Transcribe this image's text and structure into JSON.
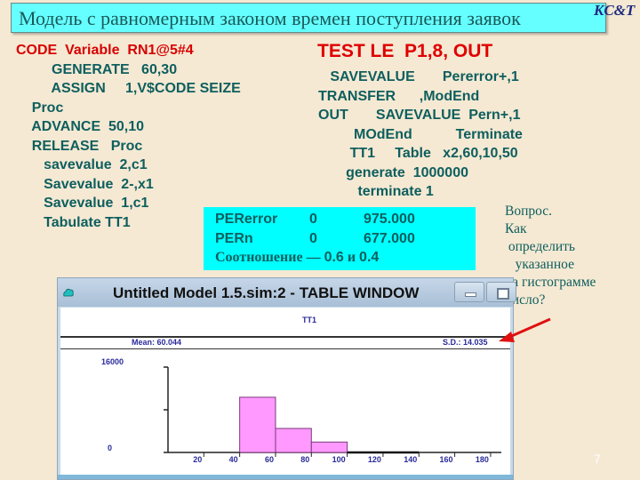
{
  "slide": {
    "title": "Модель с равномерным законом времен поступления заявок",
    "logo": "KC&T",
    "page_number": "7",
    "colors": {
      "title_bg": "#66ffff",
      "code_text": "#0e5e5e",
      "code_red": "#d80000",
      "result_bg": "#00ffff",
      "bar_fill": "#ff99ff",
      "arrow": "#e00000"
    }
  },
  "code_left": [
    {
      "text": "CODE  Variable  RN1@5#4",
      "red": true
    },
    {
      "text": "         GENERATE   60,30",
      "red": false
    },
    {
      "text": "         ASSIGN     1,V$CODE SEIZE",
      "red": false
    },
    {
      "text": "    Proc",
      "red": false
    },
    {
      "text": "    ADVANCE  50,10",
      "red": false
    },
    {
      "text": "    RELEASE   Proc",
      "red": false
    },
    {
      "text": "       savevalue  2,c1",
      "red": false
    },
    {
      "text": "       Savevalue  2-,x1",
      "red": false
    },
    {
      "text": "       Savevalue  1,c1",
      "red": false
    },
    {
      "text": "       Tabulate TT1",
      "red": false
    }
  ],
  "code_right": {
    "heading": "TEST LE  P1,8, OUT",
    "lines": [
      "   SAVEVALUE       Pererror+,1",
      "TRANSFER      ,ModEnd",
      "OUT       SAVEVALUE  Pern+,1",
      "         MOdEnd           Terminate",
      "        TT1     Table   x2,60,10,50",
      "       generate  1000000",
      "          terminate 1"
    ]
  },
  "results": {
    "rows": [
      {
        "name": "PERerror",
        "index": "0",
        "value": "975.000"
      },
      {
        "name": "PERn",
        "index": "0",
        "value": "677.000"
      }
    ],
    "ratio_label": "Соотношение — ",
    "ratio_a": "0.6",
    "ratio_and": " и ",
    "ratio_b": "0.4"
  },
  "question": {
    "lines": [
      "Вопрос.",
      "Как",
      " определить",
      "   указанное",
      "на гистограмме",
      "число?"
    ]
  },
  "window": {
    "title": "Untitled Model 1.5.sim:2  -  TABLE WINDOW",
    "table_name": "TT1",
    "mean_label": "Mean: 60.044",
    "sd_label": "S.D.: 14.035"
  },
  "chart_data": {
    "type": "bar",
    "title": "TT1",
    "xlabel": "",
    "ylabel": "",
    "x_ticks": [
      "20",
      "40",
      "60",
      "80",
      "100",
      "120",
      "140",
      "160",
      "180"
    ],
    "y_tick_labels": [
      "16000",
      "0"
    ],
    "ylim": [
      0,
      16000
    ],
    "xlim": [
      0,
      190
    ],
    "bins": [
      {
        "from": 40,
        "to": 60,
        "value": 10350
      },
      {
        "from": 60,
        "to": 80,
        "value": 4500
      },
      {
        "from": 80,
        "to": 100,
        "value": 1950
      }
    ],
    "mean": 60.044,
    "sd": 14.035,
    "grid": false
  }
}
